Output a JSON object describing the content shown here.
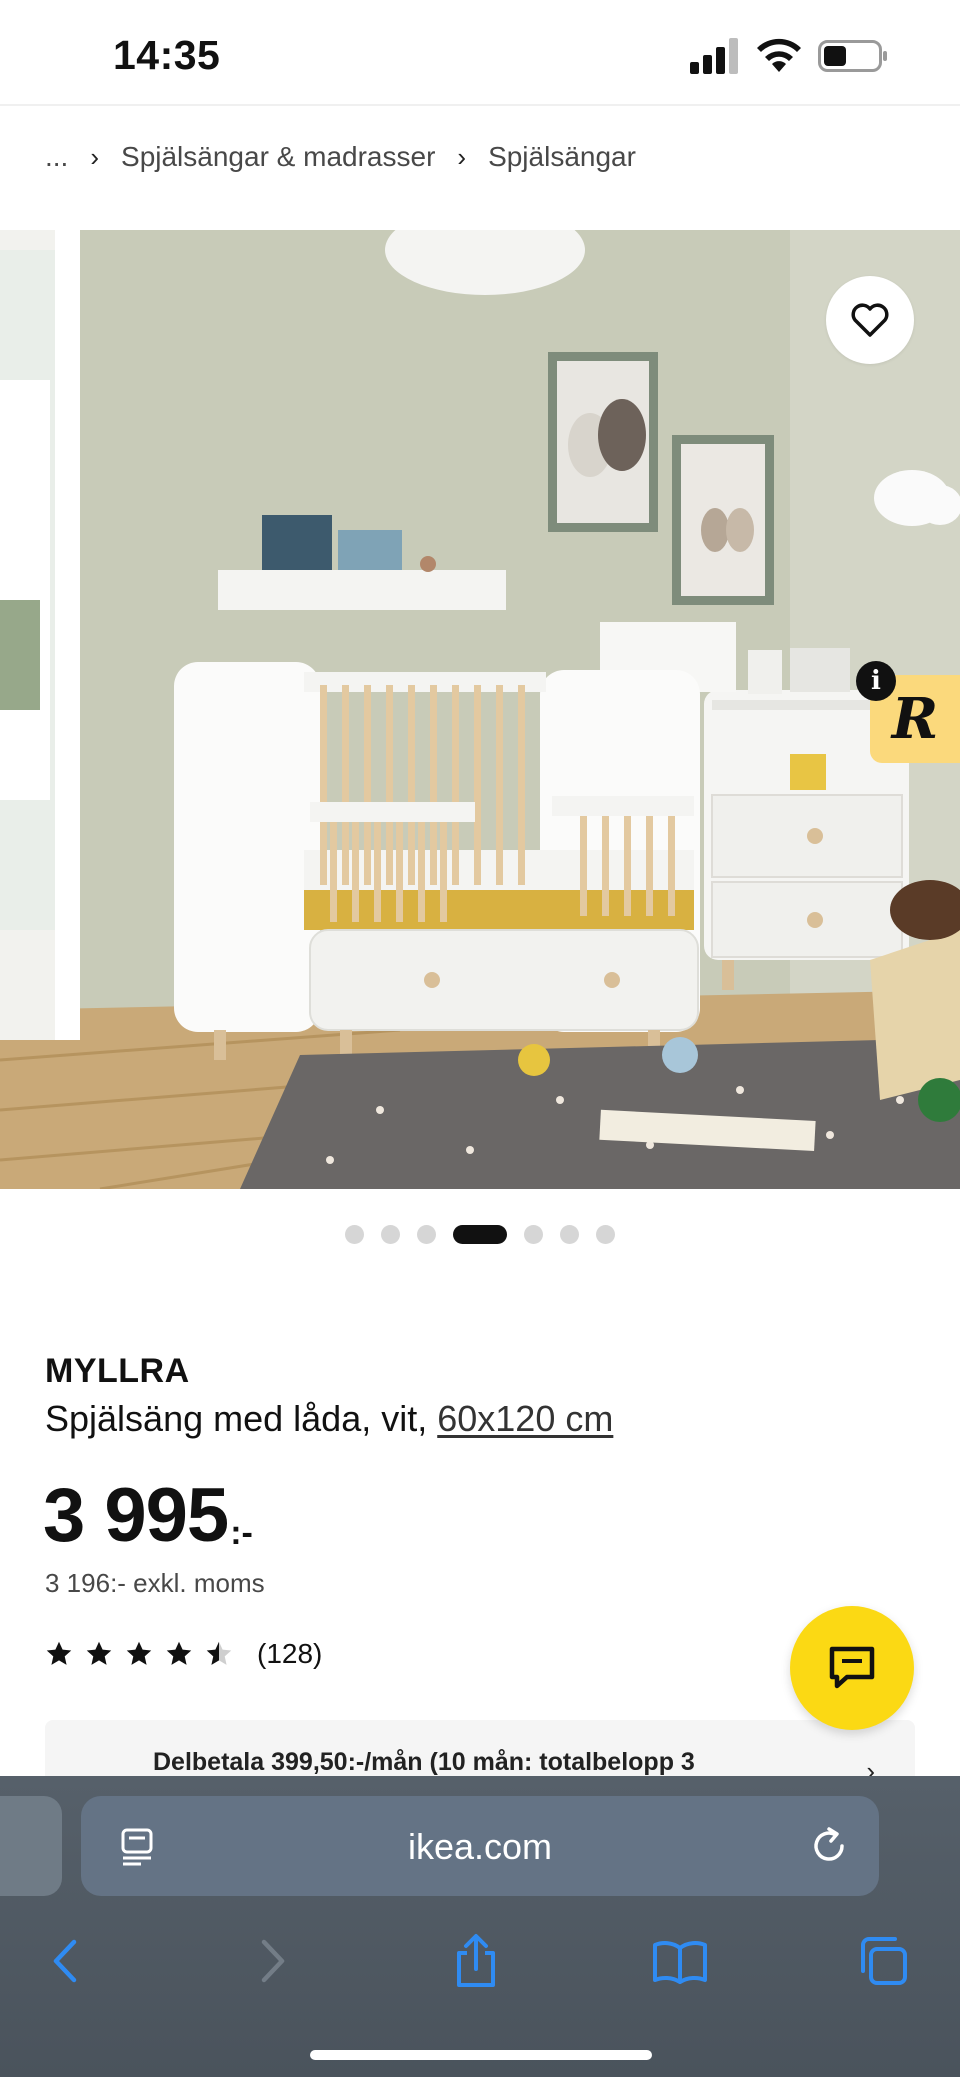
{
  "status_bar": {
    "time": "14:35"
  },
  "breadcrumb": {
    "items": [
      "...",
      "Spjälsängar & madrasser",
      "Spjälsängar"
    ],
    "separator": "›"
  },
  "hero": {
    "favorite_icon": "heart-outline-icon",
    "badge_letter": "R",
    "badge_info": "i",
    "carousel": {
      "count": 7,
      "active_index": 3
    }
  },
  "product": {
    "brand": "MYLLRA",
    "description": "Spjälsäng med låda, vit,",
    "size_link": "60x120 cm",
    "price": "3 995",
    "price_suffix": ":-",
    "price_ex_vat": "3 196:- exkl. moms",
    "rating": {
      "value": 4.5,
      "max": 5,
      "count": "(128)"
    }
  },
  "installment": {
    "text": "Delbetala 399,50:-/mån (10 mån: totalbelopp 3",
    "icon": "..",
    "arrow": "›"
  },
  "chat": {
    "icon": "chat-bubble-icon"
  },
  "browser": {
    "url": "ikea.com",
    "toolbar_icons": [
      "back-icon",
      "forward-icon",
      "share-icon",
      "bookmarks-icon",
      "tabs-icon"
    ]
  },
  "colors": {
    "accent_yellow": "#fbd914",
    "badge_yellow": "#fbd97c",
    "browser_bar": "#4f5963",
    "safari_blue": "#2f8bf2"
  }
}
